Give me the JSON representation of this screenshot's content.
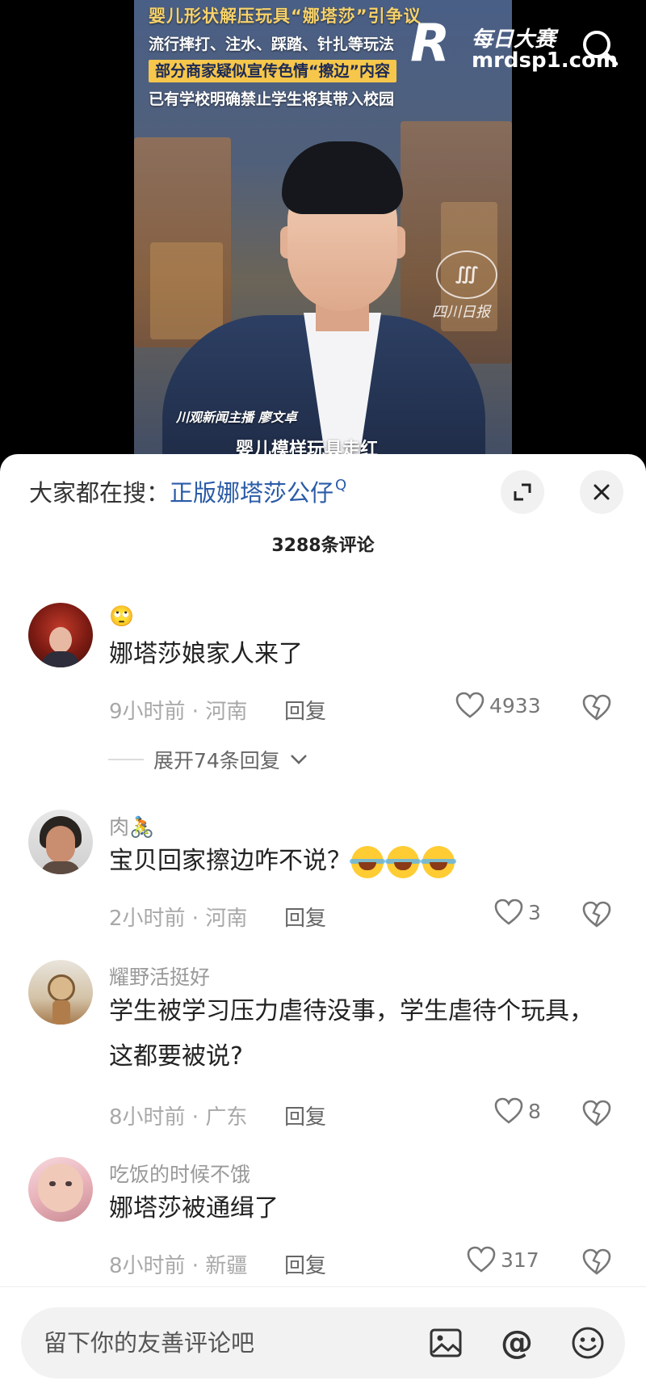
{
  "video": {
    "headline_main": "婴儿形状解压玩具“娜塔莎”引争议",
    "headline_line2": "流行摔打、注水、踩踏、针扎等玩法",
    "headline_line3": "部分商家疑似宣传色情“擦边”内容",
    "headline_line4": "已有学校明确禁止学生将其带入校园",
    "anchor_name": "川观新闻主播 廖文卓",
    "caption": "婴儿模样玩具走红",
    "logo_text": "四川日报",
    "watermark_cn": "每日大赛",
    "watermark_url": "mrdsp1.com",
    "watermark_letter": "R"
  },
  "sheet": {
    "search_prefix": "大家都在搜：",
    "search_term": "正版娜塔莎公仔",
    "search_suffix": "Q",
    "comment_count": "3288条评论"
  },
  "comments": [
    {
      "username": "🙄",
      "text": "娜塔莎娘家人来了",
      "meta": "9小时前 · 河南",
      "reply": "回复",
      "likes": "4933",
      "expand": "展开74条回复"
    },
    {
      "username": "肉🚴",
      "text": "宝贝回家擦边咋不说？",
      "meta": "2小时前 · 河南",
      "reply": "回复",
      "likes": "3"
    },
    {
      "username": "耀野活挺好",
      "text": "学生被学习压力虐待没事，学生虐待个玩具，这都要被说?",
      "meta": "8小时前 · 广东",
      "reply": "回复",
      "likes": "8"
    },
    {
      "username": "吃饭的时候不饿",
      "text": "娜塔莎被通缉了",
      "meta": "8小时前 · 新疆",
      "reply": "回复",
      "likes": "317"
    }
  ],
  "input": {
    "placeholder": "留下你的友善评论吧",
    "at_symbol": "@"
  },
  "colors": {
    "link": "#2a5ba8",
    "headline_yellow": "#f6c74b",
    "sheet_bg": "#ffffff"
  }
}
